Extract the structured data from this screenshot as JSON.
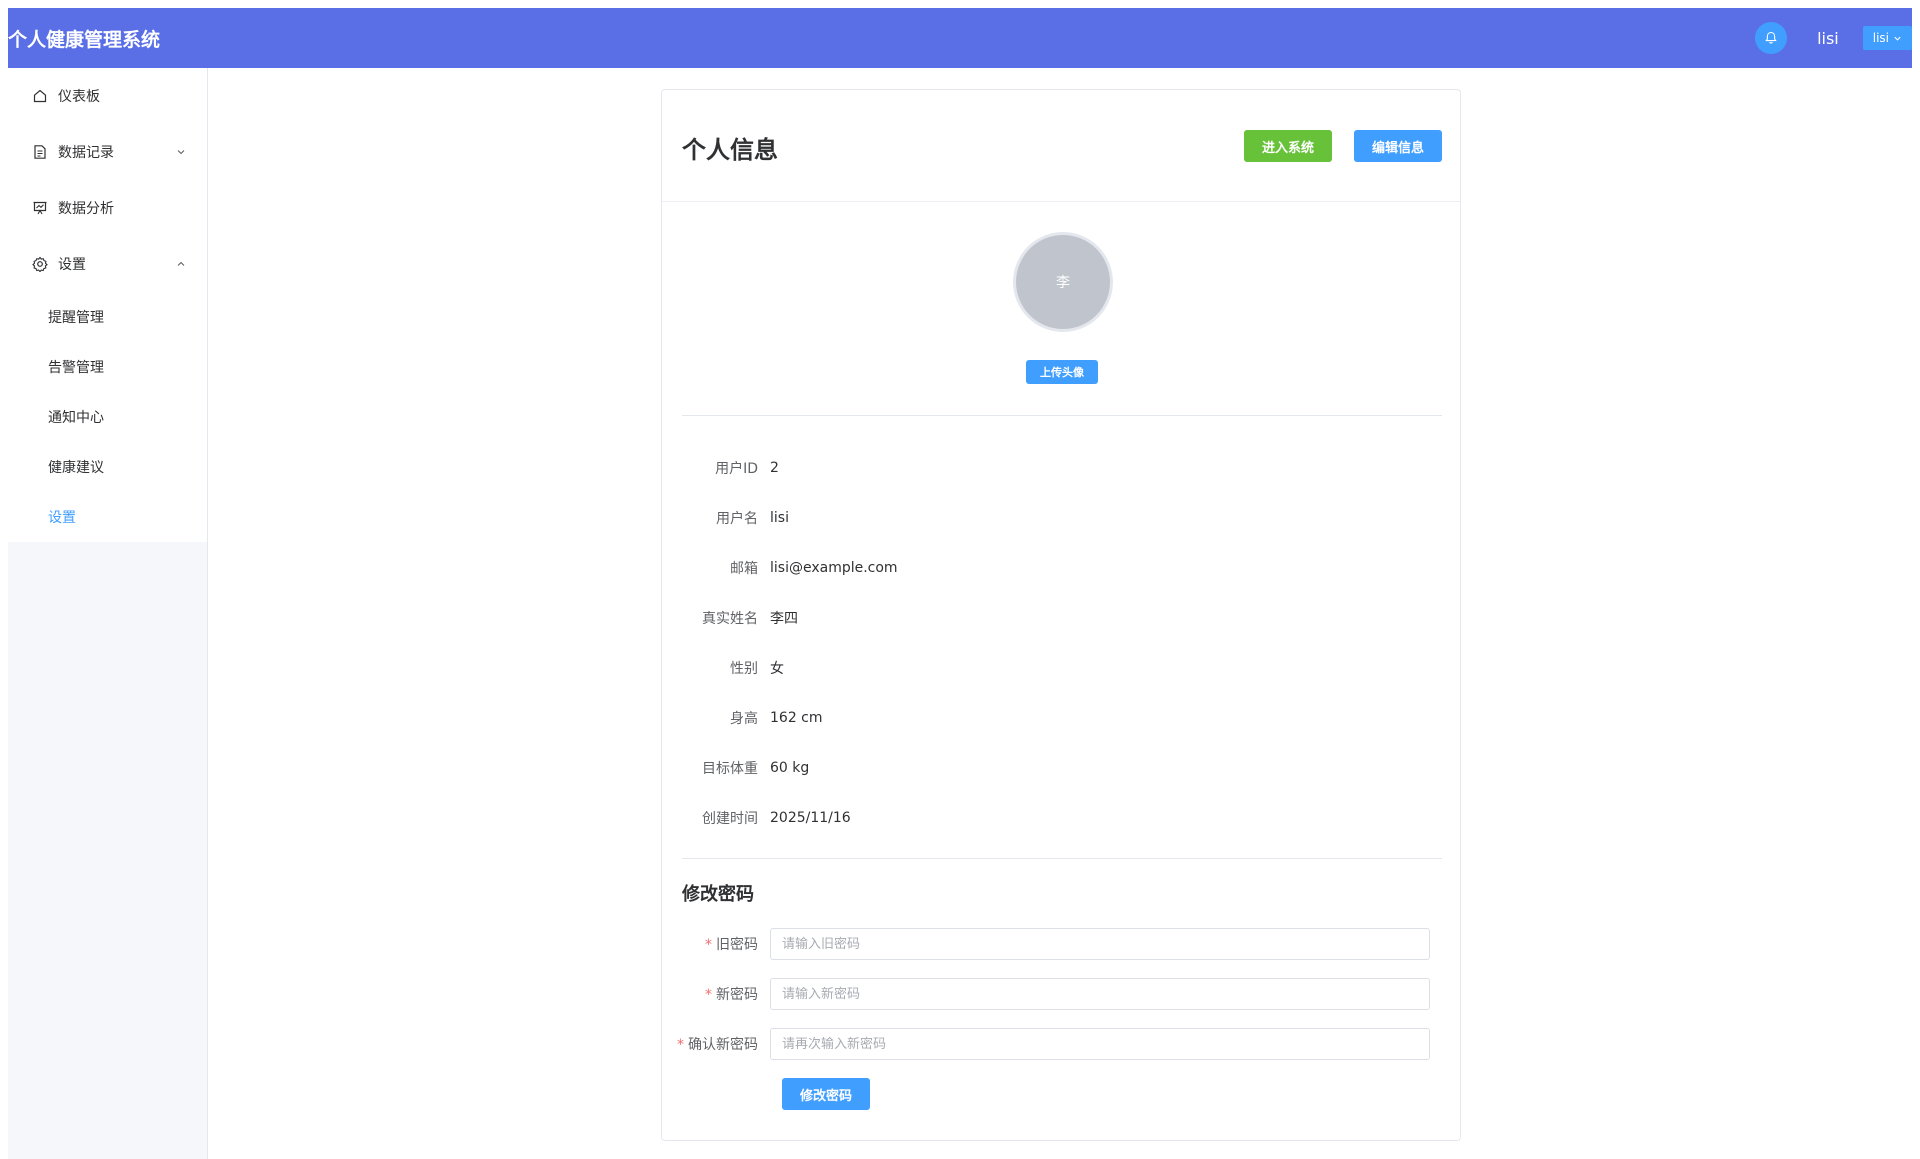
{
  "header": {
    "app_title": "个人健康管理系统",
    "username": "lisi",
    "user_menu_label": "lisi"
  },
  "sidebar": {
    "items": [
      {
        "label": "仪表板",
        "icon": "home-icon"
      },
      {
        "label": "数据记录",
        "icon": "document-icon"
      },
      {
        "label": "数据分析",
        "icon": "presentation-chart-icon"
      },
      {
        "label": "设置",
        "icon": "gear-icon"
      }
    ],
    "sub_items": [
      {
        "label": "提醒管理"
      },
      {
        "label": "告警管理"
      },
      {
        "label": "通知中心"
      },
      {
        "label": "健康建议"
      },
      {
        "label": "设置"
      }
    ]
  },
  "profile": {
    "title": "个人信息",
    "enter_system_label": "进入系统",
    "edit_info_label": "编辑信息",
    "avatar_text": "李",
    "upload_avatar_label": "上传头像",
    "fields": [
      {
        "label": "用户ID",
        "value": "2"
      },
      {
        "label": "用户名",
        "value": "lisi"
      },
      {
        "label": "邮箱",
        "value": "lisi@example.com"
      },
      {
        "label": "真实姓名",
        "value": "李四"
      },
      {
        "label": "性别",
        "value": "女"
      },
      {
        "label": "身高",
        "value": "162 cm"
      },
      {
        "label": "目标体重",
        "value": "60 kg"
      },
      {
        "label": "创建时间",
        "value": "2025/11/16"
      }
    ]
  },
  "password": {
    "title": "修改密码",
    "old_label": "旧密码",
    "old_placeholder": "请输入旧密码",
    "new_label": "新密码",
    "new_placeholder": "请输入新密码",
    "confirm_label": "确认新密码",
    "confirm_placeholder": "请再次输入新密码",
    "submit_label": "修改密码"
  },
  "colors": {
    "header_bg": "#5a6fe6",
    "primary": "#409eff",
    "success": "#67c23a"
  }
}
